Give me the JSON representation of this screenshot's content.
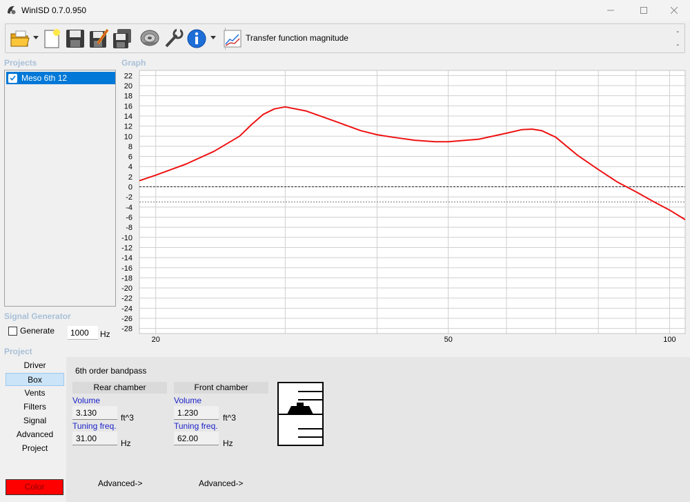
{
  "window": {
    "title": "WinISD 0.7.0.950",
    "minimize_icon": "minimize-icon",
    "maximize_icon": "maximize-icon",
    "close_icon": "close-icon"
  },
  "toolbar": {
    "graph_type_label": "Transfer function magnitude",
    "right_dash_top": "-",
    "right_dash_bottom": "-",
    "icons": [
      "open-folder-icon",
      "new-document-icon",
      "save-icon",
      "save-as-icon",
      "save-all-icon",
      "driver-icon",
      "tools-icon",
      "info-icon",
      "graph-type-icon"
    ]
  },
  "projects": {
    "section_label": "Projects",
    "items": [
      {
        "label": "Meso 6th 12",
        "checked": true
      }
    ]
  },
  "graph": {
    "section_label": "Graph"
  },
  "signal_generator": {
    "section_label": "Signal Generator",
    "generate_label": "Generate",
    "frequency_value": "1000",
    "frequency_unit": "Hz"
  },
  "project_nav": {
    "section_label": "Project",
    "items": [
      "Driver",
      "Box",
      "Vents",
      "Filters",
      "Signal",
      "Advanced",
      "Project"
    ],
    "active": "Box",
    "color_button_label": "Color",
    "color": "#ff0000"
  },
  "box": {
    "type_label": "6th order bandpass",
    "rear": {
      "header": "Rear chamber",
      "volume_label": "Volume",
      "volume_value": "3.130",
      "volume_unit": "ft^3",
      "tuning_label": "Tuning freq.",
      "tuning_value": "31.00",
      "tuning_unit": "Hz",
      "advanced_label": "Advanced->"
    },
    "front": {
      "header": "Front chamber",
      "volume_label": "Volume",
      "volume_value": "1.230",
      "volume_unit": "ft^3",
      "tuning_label": "Tuning freq.",
      "tuning_value": "62.00",
      "tuning_unit": "Hz",
      "advanced_label": "Advanced->"
    }
  },
  "chart_data": {
    "type": "line",
    "title": "",
    "xlabel": "",
    "ylabel": "",
    "x_scale": "log",
    "xlim": [
      19,
      105
    ],
    "ylim": [
      -29,
      23
    ],
    "y_ticks": [
      22,
      20,
      18,
      16,
      14,
      12,
      10,
      8,
      6,
      4,
      2,
      0,
      -2,
      -4,
      -6,
      -8,
      -10,
      -12,
      -14,
      -16,
      -18,
      -20,
      -22,
      -24,
      -26,
      -28
    ],
    "x_tick_labels": [
      20,
      50,
      100
    ],
    "x_grid": [
      20,
      30,
      40,
      50,
      60,
      70,
      80,
      90,
      100
    ],
    "grid": true,
    "reference_lines": [
      {
        "y": 0,
        "style": "dashed"
      },
      {
        "y": -3,
        "style": "dashed"
      }
    ],
    "series": [
      {
        "color": "#ee1111",
        "x": [
          19,
          20,
          22,
          24,
          26,
          27,
          28,
          29,
          30,
          32,
          35,
          38,
          40,
          42,
          45,
          48,
          50,
          55,
          60,
          63,
          65,
          67,
          70,
          75,
          80,
          85,
          90,
          95,
          100,
          105
        ],
        "y": [
          1.2,
          2.3,
          4.5,
          7.0,
          10.0,
          12.3,
          14.3,
          15.4,
          15.8,
          15.0,
          13.0,
          11.1,
          10.3,
          9.8,
          9.2,
          8.9,
          8.9,
          9.4,
          10.6,
          11.3,
          11.4,
          11.1,
          9.8,
          6.2,
          3.4,
          0.9,
          -1.0,
          -2.9,
          -4.6,
          -6.5
        ]
      }
    ]
  }
}
